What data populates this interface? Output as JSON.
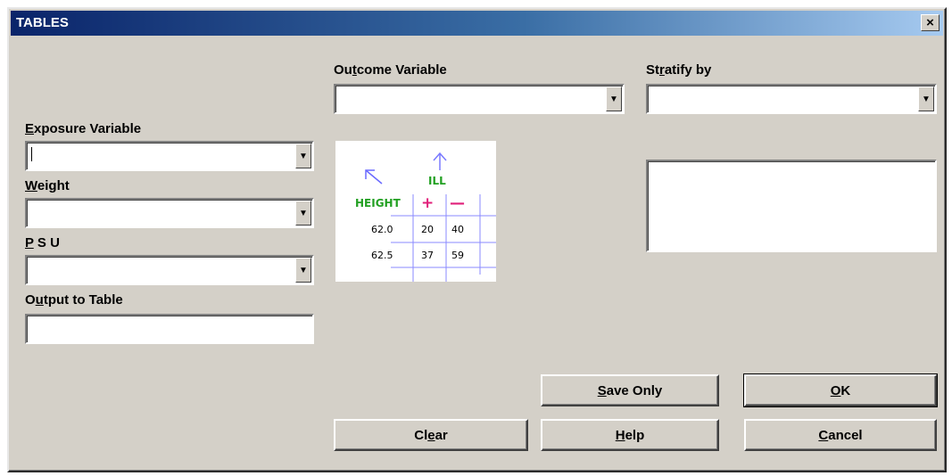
{
  "window": {
    "title": "TABLES",
    "close_glyph": "×"
  },
  "outcome": {
    "label_pre": "Ou",
    "label_u": "t",
    "label_post": "come Variable",
    "value": ""
  },
  "stratify": {
    "label_pre": "St",
    "label_u": "r",
    "label_post": "atify by",
    "value": ""
  },
  "exposure": {
    "label_pre": "",
    "label_u": "E",
    "label_post": "xposure Variable",
    "value": ""
  },
  "weight": {
    "label_pre": "",
    "label_u": "W",
    "label_post": "eight",
    "value": ""
  },
  "psu": {
    "label_pre": "",
    "label_u": "P",
    "label_post": " S U",
    "value": ""
  },
  "output_table": {
    "label_pre": "O",
    "label_u": "u",
    "label_post": "tput to Table",
    "value": ""
  },
  "illustration": {
    "ill_label": "ILL",
    "row_header": "HEIGHT",
    "plus": "+",
    "minus": "—",
    "rows": [
      {
        "height": "62.0",
        "plus": "20",
        "minus": "40"
      },
      {
        "height": "62.5",
        "plus": "37",
        "minus": "59"
      }
    ],
    "colors": {
      "green": "#22a022",
      "magenta": "#e0207a",
      "blue": "#6b6bff"
    }
  },
  "buttons": {
    "save_only": {
      "u": "S",
      "rest": "ave Only"
    },
    "ok": {
      "u": "O",
      "rest": "K"
    },
    "clear": {
      "pre": "Cl",
      "u": "e",
      "rest": "ar"
    },
    "help": {
      "u": "H",
      "rest": "elp"
    },
    "cancel": {
      "u": "C",
      "rest": "ancel"
    }
  },
  "icons": {
    "dropdown": "chevron-down-icon",
    "close": "close-icon"
  }
}
